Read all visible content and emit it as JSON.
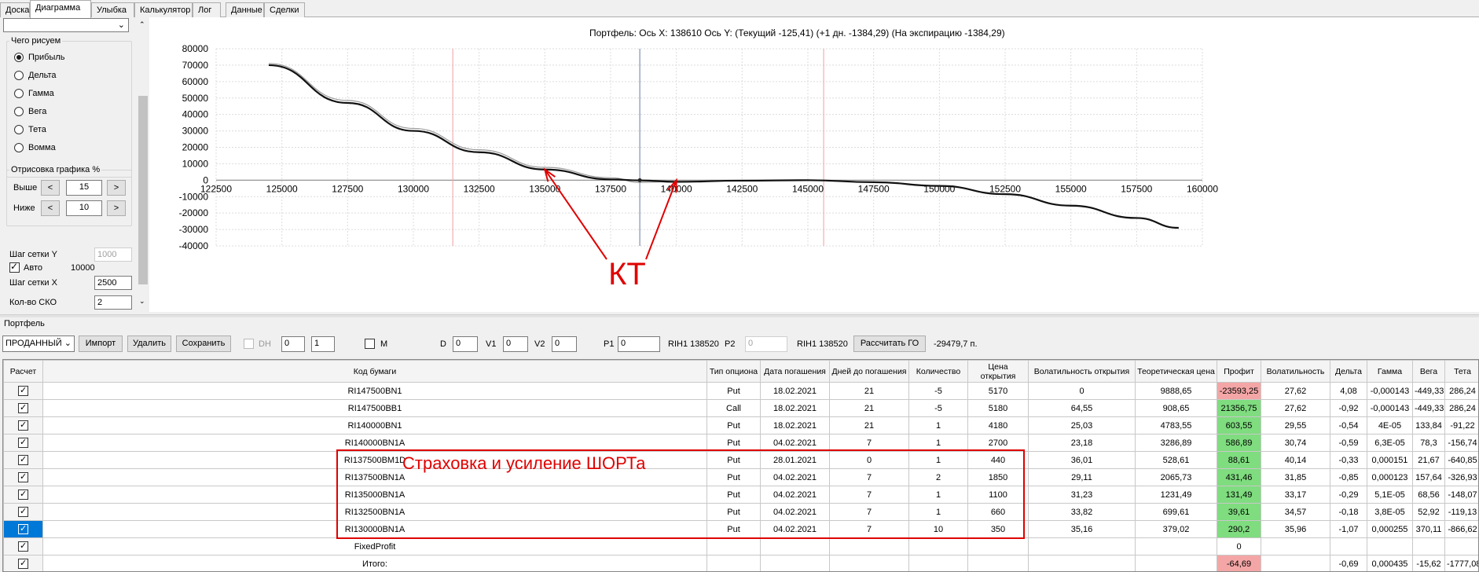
{
  "tabs": [
    "Доска",
    "Диаграмма",
    "Улыбка",
    "Калькулятор",
    "Лог",
    "Данные",
    "Сделки"
  ],
  "active_tab": "Диаграмма",
  "left": {
    "what_title": "Чего рисуем",
    "radios": [
      "Прибыль",
      "Дельта",
      "Гамма",
      "Вега",
      "Тета",
      "Вомма"
    ],
    "selected_radio": "Прибыль",
    "render_title": "Отрисовка графика %",
    "above_label": "Выше",
    "above_value": "15",
    "below_label": "Ниже",
    "below_value": "10",
    "btn_prev": "<",
    "btn_next": ">",
    "grid_y_label": "Шаг сетки Y",
    "grid_y_value": "1000",
    "auto_label": "Авто",
    "auto_value": "10000",
    "grid_x_label": "Шаг сетки X",
    "grid_x_value": "2500",
    "sko_label": "Кол-во СКО",
    "sko_value": "2"
  },
  "chart_header": {
    "prefix": "Портфель: Ось X:",
    "x_value": "138610",
    "y_label": "Ось Y:",
    "current": "(Текущий -125,41)",
    "plus1": "(+1 дн. -1384,29)",
    "expiry": "(На экспирацию -1384,29)"
  },
  "chart_data": {
    "type": "line",
    "xlabel": "",
    "ylabel": "",
    "xlim": [
      122500,
      160000
    ],
    "ylim": [
      -40000,
      80000
    ],
    "x_ticks": [
      122500,
      125000,
      127500,
      130000,
      132500,
      135000,
      137500,
      140000,
      142500,
      145000,
      147500,
      150000,
      152500,
      155000,
      157500,
      160000
    ],
    "y_ticks": [
      80000,
      70000,
      60000,
      50000,
      40000,
      30000,
      20000,
      10000,
      0,
      -10000,
      -20000,
      -30000,
      -40000
    ],
    "vertical_lines": {
      "current_price": 138610,
      "sigma_lines": [
        131500,
        145600
      ]
    },
    "series": [
      {
        "x": [
          124500,
          127500,
          130000,
          132500,
          135000,
          137500,
          138610,
          140000,
          142500,
          145000,
          147500,
          150000,
          152500,
          155000,
          157500,
          159100
        ],
        "values": [
          70000,
          47000,
          30000,
          17000,
          6500,
          500,
          -125,
          -1000,
          -300,
          0,
          -1200,
          -3500,
          -8500,
          -15500,
          -23000,
          -29000
        ]
      },
      {
        "x": [
          124500,
          127500,
          130000,
          132500,
          135000,
          137500,
          138610,
          140000,
          142500,
          145000
        ],
        "values": [
          71000,
          48500,
          31500,
          18500,
          7800,
          1500,
          -1384,
          -700,
          -200,
          0
        ]
      }
    ],
    "annotation": "КТ"
  },
  "toolbar": {
    "portfolio_label": "Портфель",
    "portfolio_value": "ПРОДАННЫЙ",
    "import": "Импорт",
    "delete": "Удалить",
    "save": "Сохранить",
    "dh": "DH",
    "dh_a": "0",
    "dh_b": "1",
    "m": "M",
    "d_label": "D",
    "d_value": "0",
    "v1_label": "V1",
    "v1_value": "0",
    "v2_label": "V2",
    "v2_value": "0",
    "p1_label": "P1",
    "p1_value": "0",
    "p1_code": "RIH1 138520",
    "p2_label": "P2",
    "p2_value": "0",
    "p2_code": "RIH1 138520",
    "calc_go": "Рассчитать ГО",
    "go_value": "-29479,7 п."
  },
  "table": {
    "headers": [
      "Расчет",
      "Код бумаги",
      "Тип опциона",
      "Дата погашения",
      "Дней до погашения",
      "Количество",
      "Цена открытия",
      "Волатильность открытия",
      "Теоретическая цена",
      "Профит",
      "Волатильность",
      "Дельта",
      "Гамма",
      "Вега",
      "Тета"
    ],
    "rows": [
      {
        "code": "RI147500BN1",
        "type": "Put",
        "date": "18.02.2021",
        "days": "21",
        "qty": "-5",
        "price": "5170",
        "vol_open": "0",
        "theo": "9888,65",
        "profit": "-23593,25",
        "profit_sign": "neg",
        "vol": "27,62",
        "delta": "4,08",
        "gamma": "-0,000143",
        "vega": "-449,33",
        "theta": "286,24"
      },
      {
        "code": "RI147500BB1",
        "type": "Call",
        "date": "18.02.2021",
        "days": "21",
        "qty": "-5",
        "price": "5180",
        "vol_open": "64,55",
        "theo": "908,65",
        "profit": "21356,75",
        "profit_sign": "pos",
        "vol": "27,62",
        "delta": "-0,92",
        "gamma": "-0,000143",
        "vega": "-449,33",
        "theta": "286,24"
      },
      {
        "code": "RI140000BN1",
        "type": "Put",
        "date": "18.02.2021",
        "days": "21",
        "qty": "1",
        "price": "4180",
        "vol_open": "25,03",
        "theo": "4783,55",
        "profit": "603,55",
        "profit_sign": "pos",
        "vol": "29,55",
        "delta": "-0,54",
        "gamma": "4E-05",
        "vega": "133,84",
        "theta": "-91,22"
      },
      {
        "code": "RI140000BN1A",
        "type": "Put",
        "date": "04.02.2021",
        "days": "7",
        "qty": "1",
        "price": "2700",
        "vol_open": "23,18",
        "theo": "3286,89",
        "profit": "586,89",
        "profit_sign": "pos",
        "vol": "30,74",
        "delta": "-0,59",
        "gamma": "6,3E-05",
        "vega": "78,3",
        "theta": "-156,74"
      },
      {
        "code": "RI137500BM1D",
        "type": "Put",
        "date": "28.01.2021",
        "days": "0",
        "qty": "1",
        "price": "440",
        "vol_open": "36,01",
        "theo": "528,61",
        "profit": "88,61",
        "profit_sign": "pos",
        "vol": "40,14",
        "delta": "-0,33",
        "gamma": "0,000151",
        "vega": "21,67",
        "theta": "-640,85"
      },
      {
        "code": "RI137500BN1A",
        "type": "Put",
        "date": "04.02.2021",
        "days": "7",
        "qty": "2",
        "price": "1850",
        "vol_open": "29,11",
        "theo": "2065,73",
        "profit": "431,46",
        "profit_sign": "pos",
        "vol": "31,85",
        "delta": "-0,85",
        "gamma": "0,000123",
        "vega": "157,64",
        "theta": "-326,93"
      },
      {
        "code": "RI135000BN1A",
        "type": "Put",
        "date": "04.02.2021",
        "days": "7",
        "qty": "1",
        "price": "1100",
        "vol_open": "31,23",
        "theo": "1231,49",
        "profit": "131,49",
        "profit_sign": "pos",
        "vol": "33,17",
        "delta": "-0,29",
        "gamma": "5,1E-05",
        "vega": "68,56",
        "theta": "-148,07"
      },
      {
        "code": "RI132500BN1A",
        "type": "Put",
        "date": "04.02.2021",
        "days": "7",
        "qty": "1",
        "price": "660",
        "vol_open": "33,82",
        "theo": "699,61",
        "profit": "39,61",
        "profit_sign": "pos",
        "vol": "34,57",
        "delta": "-0,18",
        "gamma": "3,8E-05",
        "vega": "52,92",
        "theta": "-119,13"
      },
      {
        "code": "RI130000BN1A",
        "type": "Put",
        "date": "04.02.2021",
        "days": "7",
        "qty": "10",
        "price": "350",
        "vol_open": "35,16",
        "theo": "379,02",
        "profit": "290,2",
        "profit_sign": "pos",
        "vol": "35,96",
        "delta": "-1,07",
        "gamma": "0,000255",
        "vega": "370,11",
        "theta": "-866,62"
      },
      {
        "code": "FixedProfit",
        "type": "",
        "date": "",
        "days": "",
        "qty": "",
        "price": "",
        "vol_open": "",
        "theo": "",
        "profit": "0",
        "profit_sign": "none",
        "vol": "",
        "delta": "",
        "gamma": "",
        "vega": "",
        "theta": ""
      },
      {
        "code": "Итого:",
        "type": "",
        "date": "",
        "days": "",
        "qty": "",
        "price": "",
        "vol_open": "",
        "theo": "",
        "profit": "-64,69",
        "profit_sign": "neg",
        "vol": "",
        "delta": "-0,69",
        "gamma": "0,000435",
        "vega": "-15,62",
        "theta": "-1777,08"
      }
    ]
  },
  "overlay": {
    "box_text": "Страховка и усиление ШОРТа",
    "color": "#e00000"
  }
}
